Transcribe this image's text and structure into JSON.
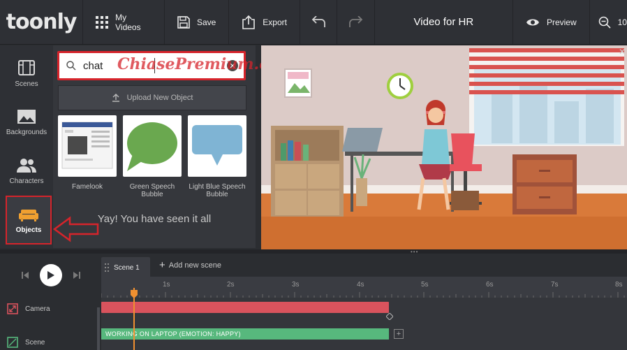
{
  "app": {
    "logo_text": "toonly",
    "title": "Video for HR"
  },
  "toolbar": {
    "my_videos_label": "My Videos",
    "save_label": "Save",
    "export_label": "Export",
    "preview_label": "Preview",
    "zoom_label": "10"
  },
  "nav": {
    "items": [
      {
        "label": "Scenes",
        "icon": "scenes-icon"
      },
      {
        "label": "Backgrounds",
        "icon": "backgrounds-icon"
      },
      {
        "label": "Characters",
        "icon": "characters-icon"
      },
      {
        "label": "Objects",
        "icon": "sofa-icon",
        "active": true
      }
    ]
  },
  "panel": {
    "search_value": "chat",
    "upload_label": "Upload New Object",
    "results": [
      {
        "label": "Famelook"
      },
      {
        "label": "Green Speech Bubble"
      },
      {
        "label": "Light Blue Speech Bubble"
      }
    ],
    "end_message": "Yay! You have seen it all"
  },
  "watermark": "ChiasePremium.com",
  "timeline": {
    "scene_tab": "Scene 1",
    "add_scene_label": "Add new scene",
    "ruler_labels": [
      "1s",
      "2s",
      "3s",
      "4s",
      "5s",
      "6s",
      "7s",
      "8s"
    ],
    "tracks": [
      {
        "label": "Camera",
        "icon": "camera-track-icon"
      },
      {
        "label": "Scene",
        "icon": "scene-track-icon"
      }
    ],
    "scene_bar_label": "WORKING ON LAPTOP (EMOTION: HAPPY)"
  },
  "colors": {
    "accent_red": "#d6242b",
    "camera_bar": "#d9535d",
    "scene_bar": "#57b87d",
    "playhead": "#f09030",
    "objects_icon": "#f0a030"
  }
}
